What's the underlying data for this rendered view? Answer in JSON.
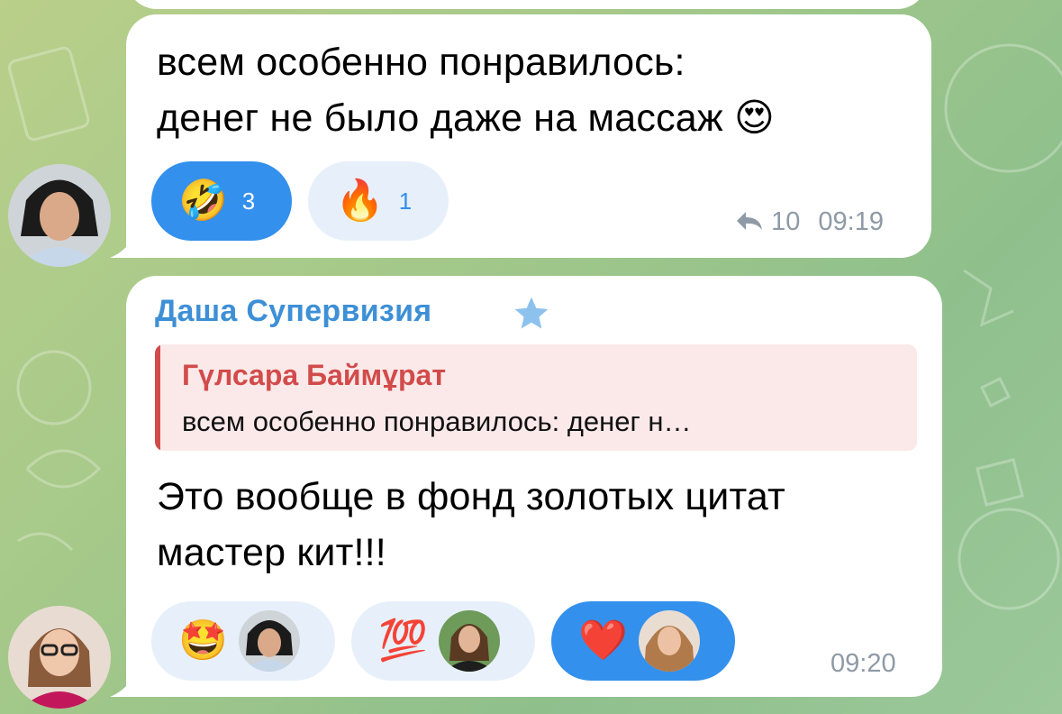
{
  "messages": [
    {
      "text_line1": "всем особенно понравилось:",
      "text_line2": "денег не было даже на массаж",
      "inline_emoji": "😍",
      "reactions": [
        {
          "emoji": "🤣",
          "count": "3",
          "active": true
        },
        {
          "emoji": "🔥",
          "count": "1",
          "active": false
        }
      ],
      "forward_icon": "reply-arrow-icon",
      "forward_count": "10",
      "time": "09:19"
    },
    {
      "sender": "Даша Супервизия",
      "sender_badge": "star-icon",
      "reply": {
        "name": "Гүлсара Баймұрат",
        "text": "всем особенно понравилось: денег н…"
      },
      "text_line1": "Это вообще в фонд золотых цитат",
      "text_line2": "мастер кит!!!",
      "reactions": [
        {
          "emoji": "🤩",
          "active": false
        },
        {
          "emoji": "💯",
          "active": false
        },
        {
          "emoji": "❤️",
          "active": true
        }
      ],
      "time": "09:20"
    }
  ],
  "colors": {
    "accent": "#3390ec",
    "sender_name": "#3d8fd6",
    "reply_name": "#d24b4b",
    "reply_bg": "#fbe9e9",
    "meta": "#8e9aa6"
  }
}
